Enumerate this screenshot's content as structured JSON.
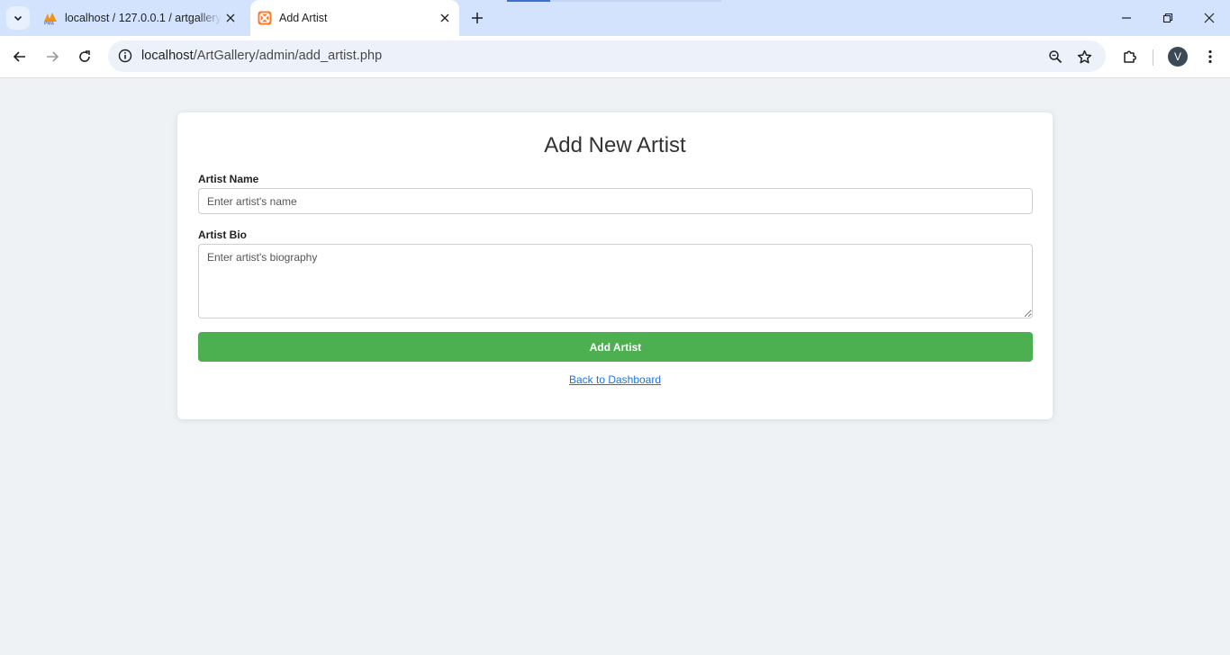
{
  "browser": {
    "tabs": [
      {
        "title": "localhost / 127.0.0.1 / artgallery",
        "favicon": "phpmyadmin-icon",
        "active": false
      },
      {
        "title": "Add Artist",
        "favicon": "xampp-icon",
        "active": true
      }
    ],
    "address": {
      "host": "localhost",
      "path": "/ArtGallery/admin/add_artist.php"
    },
    "profile_initial": "V"
  },
  "page": {
    "heading": "Add New Artist",
    "form": {
      "name_label": "Artist Name",
      "name_placeholder": "Enter artist's name",
      "name_value": "",
      "bio_label": "Artist Bio",
      "bio_placeholder": "Enter artist's biography",
      "bio_value": "",
      "submit_label": "Add Artist"
    },
    "back_link": "Back to Dashboard"
  },
  "colors": {
    "page_background": "#eff2f5",
    "submit_button": "#4caf50",
    "link": "#1a73e8",
    "tabstrip": "#d3e3fd"
  }
}
